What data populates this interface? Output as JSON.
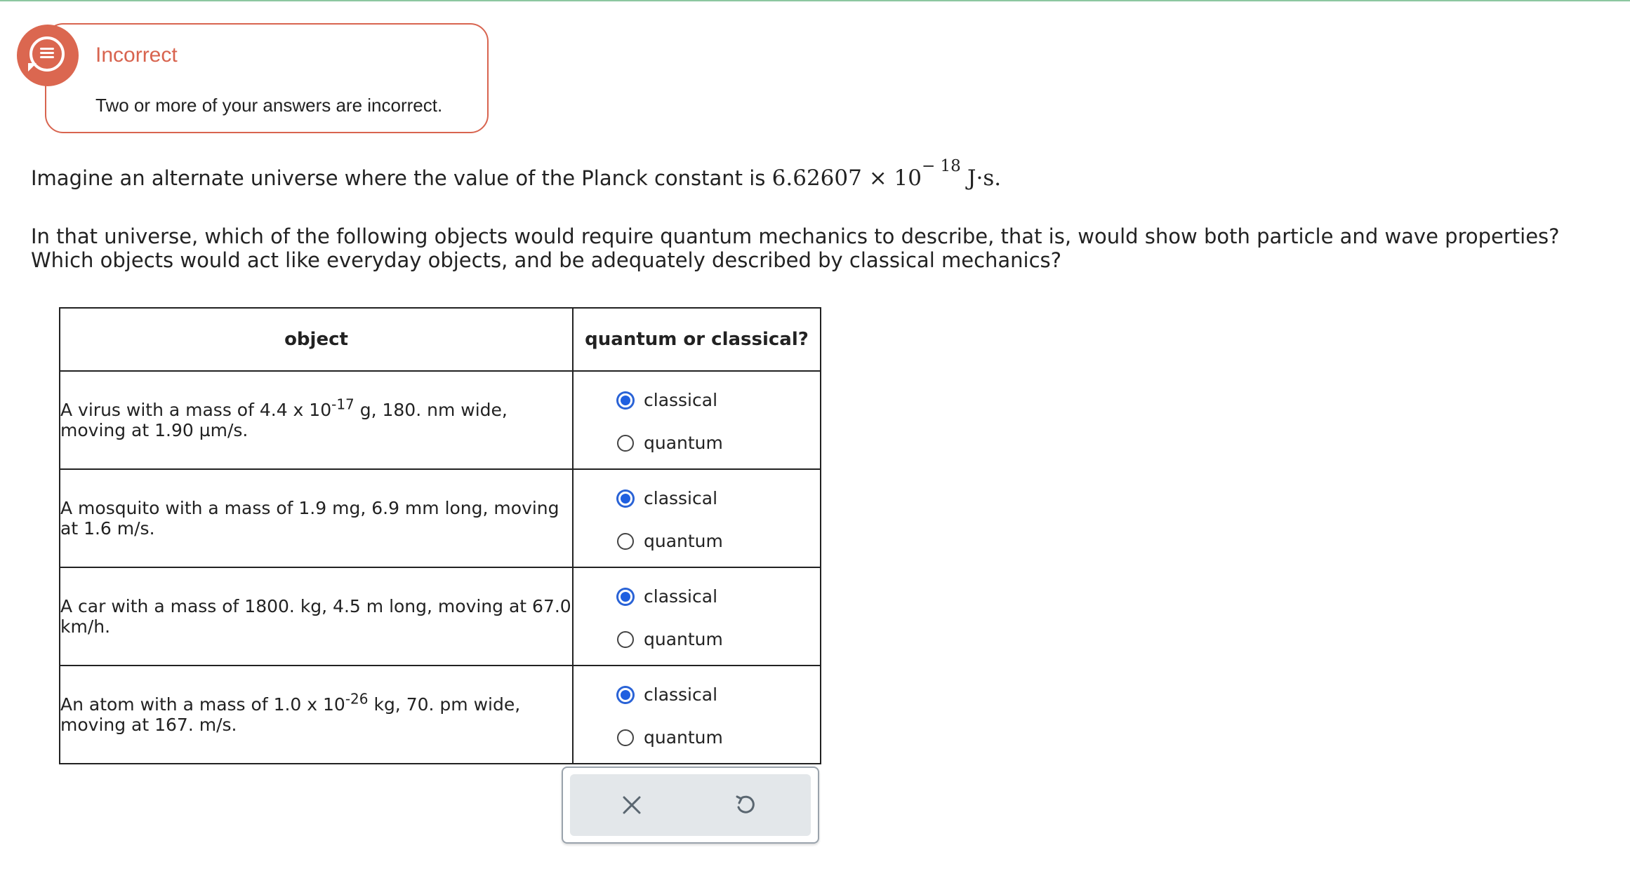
{
  "feedback": {
    "title": "Incorrect",
    "message": "Two or more of your answers are incorrect.",
    "icon": "feedback-bubble-icon",
    "accent_color": "#d8644f"
  },
  "question": {
    "intro": "Imagine an alternate universe where the value of the Planck constant is",
    "constant_mantissa": "6.62607 × 10",
    "constant_exponent": "− 18",
    "constant_unit": "J·s.",
    "prompt": "In that universe, which of the following objects would require quantum mechanics to describe, that is, would show both particle and wave properties? Which objects would act like everyday objects, and be adequately described by classical mechanics?"
  },
  "table": {
    "headers": {
      "object": "object",
      "choice": "quantum or classical?"
    },
    "rows": [
      {
        "desc_before": "A virus with a mass of 4.4 x 10",
        "desc_sup": "-17",
        "desc_after": " g, 180. nm wide, moving at 1.90 µm/s.",
        "option1": "classical",
        "option2": "quantum",
        "selected": "classical"
      },
      {
        "desc_before": "A mosquito with a mass of 1.9 mg, 6.9 mm long, moving at 1.6 m/s.",
        "desc_sup": "",
        "desc_after": "",
        "option1": "classical",
        "option2": "quantum",
        "selected": "classical"
      },
      {
        "desc_before": "A car with a mass of 1800. kg, 4.5 m long, moving at 67.0 km/h.",
        "desc_sup": "",
        "desc_after": "",
        "option1": "classical",
        "option2": "quantum",
        "selected": "classical"
      },
      {
        "desc_before": "An atom with a mass of 1.0 x 10",
        "desc_sup": "-26",
        "desc_after": " kg, 70. pm wide, moving at 167. m/s.",
        "option1": "classical",
        "option2": "quantum",
        "selected": "classical"
      }
    ]
  },
  "toolbar": {
    "clear_icon": "close-icon",
    "reset_icon": "undo-icon"
  },
  "colors": {
    "radio_selected": "#1f5fe0",
    "top_rule": "#8cc7a0"
  }
}
